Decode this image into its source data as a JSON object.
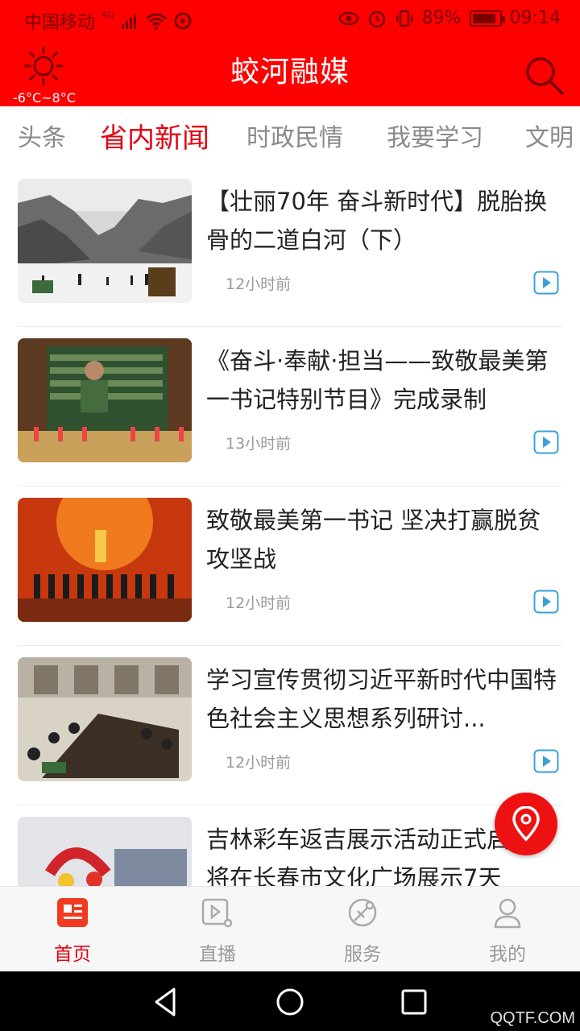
{
  "status_bar": {
    "carrier": "中国移动",
    "network": "4G",
    "battery": "89%",
    "battery_level": 0.89,
    "time": "09:14"
  },
  "header": {
    "title": "蛟河融媒",
    "weather_temp": "-6°C~8°C",
    "weather_icon": "sun-icon",
    "search_icon": "search-icon"
  },
  "tabs": [
    {
      "label": "头条",
      "active": false
    },
    {
      "label": "省内新闻",
      "active": true
    },
    {
      "label": "时政民情",
      "active": false
    },
    {
      "label": "我要学习",
      "active": false
    },
    {
      "label": "文明",
      "active": false
    }
  ],
  "news": [
    {
      "title": "【壮丽70年 奋斗新时代】脱胎换骨的二道白河（下）",
      "time": "12小时前",
      "thumb": "snowy-mountain"
    },
    {
      "title": "《奋斗·奉献·担当——致敬最美第一书记特别节目》完成录制",
      "time": "13小时前",
      "thumb": "field-farmer"
    },
    {
      "title": "致敬最美第一书记 坚决打赢脱贫攻坚战",
      "time": "12小时前",
      "thumb": "stage-ceremony"
    },
    {
      "title": "学习宣传贯彻习近平新时代中国特色社会主义思想系列研讨...",
      "time": "12小时前",
      "thumb": "meeting-room"
    },
    {
      "title": "吉林彩车返吉展示活动正式启动 将在长春市文化广场展示7天",
      "time": "",
      "thumb": "parade-float"
    }
  ],
  "bottom_nav": [
    {
      "label": "首页",
      "icon": "news-icon",
      "active": true
    },
    {
      "label": "直播",
      "icon": "live-video-icon",
      "active": false
    },
    {
      "label": "服务",
      "icon": "service-icon",
      "active": false
    },
    {
      "label": "我的",
      "icon": "user-icon",
      "active": false
    }
  ],
  "watermark": "QQTF.COM",
  "colors": {
    "brand_red": "#ff0000",
    "active_red": "#e60012",
    "play_blue": "#3aa0d8"
  }
}
